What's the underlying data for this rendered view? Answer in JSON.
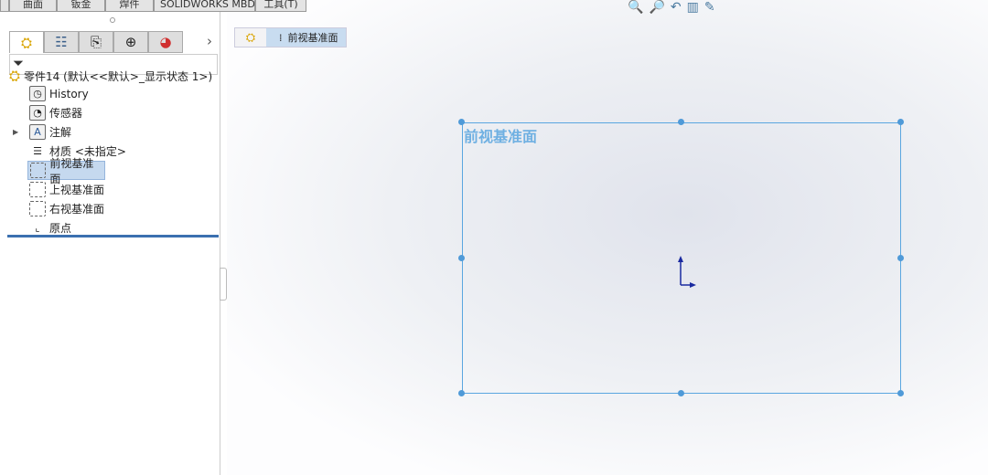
{
  "command_tabs": [
    "曲面",
    "钣金",
    "焊件",
    "SOLIDWORKS MBD",
    "工具(T)"
  ],
  "panel_tabs": [
    {
      "icon": "feature-manager-icon"
    },
    {
      "icon": "property-manager-icon"
    },
    {
      "icon": "configuration-manager-icon"
    },
    {
      "icon": "dimxpert-icon"
    },
    {
      "icon": "display-manager-icon"
    }
  ],
  "root": "零件14  (默认<<默认>_显示状态 1>)",
  "tree": [
    {
      "label": "History",
      "icon": "history-folder-icon"
    },
    {
      "label": "传感器",
      "icon": "sensor-folder-icon"
    },
    {
      "label": "注解",
      "icon": "annotation-folder-icon"
    },
    {
      "label": "材质 <未指定>",
      "icon": "material-icon"
    },
    {
      "label": "前视基准面",
      "icon": "plane-icon",
      "selected": true
    },
    {
      "label": "上视基准面",
      "icon": "plane-icon"
    },
    {
      "label": "右视基准面",
      "icon": "plane-icon"
    },
    {
      "label": "原点",
      "icon": "origin-icon"
    }
  ],
  "breadcrumb": "前视基准面",
  "plane_label": "前视基准面",
  "colors": {
    "plane": "#5aa6e0",
    "selection": "#c5d9ef",
    "separator": "#3b70b0"
  }
}
